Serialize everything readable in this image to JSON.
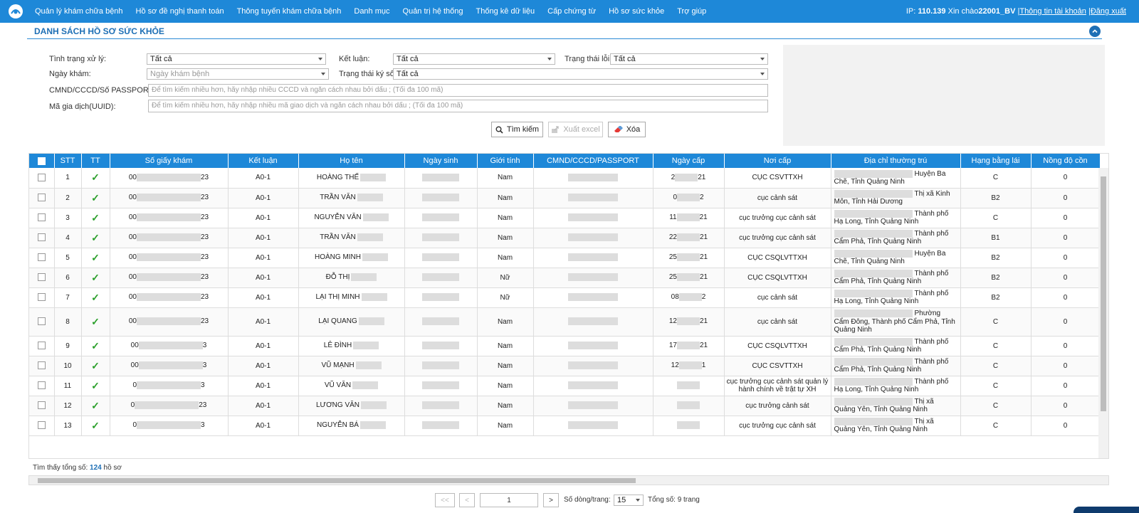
{
  "nav": {
    "items": [
      "Quản lý khám chữa bệnh",
      "Hồ sơ đề nghị thanh toán",
      "Thông tuyến khám chữa bệnh",
      "Danh mục",
      "Quản trị hệ thống",
      "Thống kê dữ liệu",
      "Cấp chứng từ",
      "Hồ sơ sức khỏe",
      "Trợ giúp"
    ],
    "ip_label": "IP:",
    "ip": "110.139",
    "greeting": "Xin chào",
    "user": "22001_BV",
    "sep": "|",
    "account": "Thông tin tài khoản",
    "logout": "Đăng xuất"
  },
  "section": {
    "title": "DANH SÁCH HỒ SƠ SỨC KHỎE"
  },
  "filters": {
    "status_label": "Tình trạng xử lý:",
    "status_value": "Tất cả",
    "conclusion_label": "Kết luận:",
    "conclusion_value": "Tất cả",
    "error_label": "Trạng thái lỗi:",
    "error_value": "Tất cả",
    "date_label": "Ngày khám:",
    "date_placeholder": "Ngày khám bệnh",
    "sign_label": "Trạng thái ký số:",
    "sign_value": "Tất cả",
    "id_label": "CMND/CCCD/Số PASSPORT:",
    "id_placeholder": "Để tìm kiếm nhiều hơn, hãy nhập nhiều CCCD và ngăn cách nhau bởi dấu ; (Tối đa 100 mã)",
    "uuid_label": "Mã gia dịch(UUID):",
    "uuid_placeholder": "Để tìm kiếm nhiều hơn, hãy nhập nhiều mã giao dịch và ngăn cách nhau bởi dấu ; (Tối đa 100 mã)"
  },
  "buttons": {
    "search": "Tìm kiếm",
    "export": "Xuất excel",
    "clear": "Xóa"
  },
  "table": {
    "headers": [
      "STT",
      "TT",
      "Số giấy khám",
      "Kết luận",
      "Họ tên",
      "Ngày sinh",
      "Giới tính",
      "CMND/CCCD/PASSPORT",
      "Ngày cấp",
      "Nơi cấp",
      "Địa chỉ thường trú",
      "Hạng bằng lái",
      "Nồng độ cồn"
    ],
    "rows": [
      {
        "stt": "1",
        "so_a": "00",
        "so_b": "23",
        "kl": "A0-1",
        "name": "HOÀNG THẾ",
        "gender": "Nam",
        "nc_a": "2",
        "nc_b": "21",
        "noi": "CỤC CSVTTXH",
        "addr": "Huyện Ba Chẽ, Tỉnh Quảng Ninh",
        "hang": "C",
        "cn": "0"
      },
      {
        "stt": "2",
        "so_a": "00",
        "so_b": "23",
        "kl": "A0-1",
        "name": "TRẦN VĂN",
        "gender": "Nam",
        "nc_a": "0",
        "nc_b": "2",
        "noi": "cục cảnh sát",
        "addr": "Thị xã Kinh Môn, Tỉnh Hải Dương",
        "hang": "B2",
        "cn": "0"
      },
      {
        "stt": "3",
        "so_a": "00",
        "so_b": "23",
        "kl": "A0-1",
        "name": "NGUYỄN VĂN",
        "gender": "Nam",
        "nc_a": "11",
        "nc_b": "21",
        "noi": "cục trưởng cục cảnh sát",
        "addr": "Thành phố Hạ Long, Tỉnh Quảng Ninh",
        "hang": "C",
        "cn": "0"
      },
      {
        "stt": "4",
        "so_a": "00",
        "so_b": "23",
        "kl": "A0-1",
        "name": "TRẦN VĂN",
        "gender": "Nam",
        "nc_a": "22",
        "nc_b": "21",
        "noi": "cục trưởng cục cảnh sát",
        "addr": "Thành phố Cẩm Phả, Tỉnh Quảng Ninh",
        "hang": "B1",
        "cn": "0"
      },
      {
        "stt": "5",
        "so_a": "00",
        "so_b": "23",
        "kl": "A0-1",
        "name": "HOÀNG MINH",
        "gender": "Nam",
        "nc_a": "25",
        "nc_b": "21",
        "noi": "CỤC CSQLVTTXH",
        "addr": "Huyện Ba Chẽ, Tỉnh Quảng Ninh",
        "hang": "B2",
        "cn": "0"
      },
      {
        "stt": "6",
        "so_a": "00",
        "so_b": "23",
        "kl": "A0-1",
        "name": "ĐỖ THỊ",
        "gender": "Nữ",
        "nc_a": "25",
        "nc_b": "21",
        "noi": "CỤC CSQLVTTXH",
        "addr": "Thành phố Cẩm Phả, Tỉnh Quảng Ninh",
        "hang": "B2",
        "cn": "0"
      },
      {
        "stt": "7",
        "so_a": "00",
        "so_b": "23",
        "kl": "A0-1",
        "name": "LẠI THỊ MINH",
        "gender": "Nữ",
        "nc_a": "08",
        "nc_b": "2",
        "noi": "cục cảnh sát",
        "addr": "Thành phố Hạ Long, Tỉnh Quảng Ninh",
        "hang": "B2",
        "cn": "0"
      },
      {
        "stt": "8",
        "so_a": "00",
        "so_b": "23",
        "kl": "A0-1",
        "name": "LẠI QUANG",
        "gender": "Nam",
        "nc_a": "12",
        "nc_b": "21",
        "noi": "cục cảnh sát",
        "addr": "Phường Cẩm Đông, Thành phố Cẩm Phả, Tỉnh Quảng Ninh",
        "hang": "C",
        "cn": "0"
      },
      {
        "stt": "9",
        "so_a": "00",
        "so_b": "3",
        "kl": "A0-1",
        "name": "LÊ ĐÌNH",
        "gender": "Nam",
        "nc_a": "17",
        "nc_b": "21",
        "noi": "CỤC CSQLVTTXH",
        "addr": "Thành phố Cẩm Phả, Tỉnh Quảng Ninh",
        "hang": "C",
        "cn": "0"
      },
      {
        "stt": "10",
        "so_a": "00",
        "so_b": "3",
        "kl": "A0-1",
        "name": "VŨ MẠNH",
        "gender": "Nam",
        "nc_a": "12",
        "nc_b": "1",
        "noi": "CỤC CSVTTXH",
        "addr": "Thành phố Cẩm Phả, Tỉnh Quảng Ninh",
        "hang": "C",
        "cn": "0"
      },
      {
        "stt": "11",
        "so_a": "0",
        "so_b": "3",
        "kl": "A0-1",
        "name": "VŨ VĂN",
        "gender": "Nam",
        "nc_a": "",
        "nc_b": "",
        "noi": "cục trưởng cục cảnh sát quản lý hành chính về trật tự XH",
        "addr": "Thành phố Hạ Long, Tỉnh Quảng Ninh",
        "hang": "C",
        "cn": "0"
      },
      {
        "stt": "12",
        "so_a": "0",
        "so_b": "23",
        "kl": "A0-1",
        "name": "LƯƠNG VĂN",
        "gender": "Nam",
        "nc_a": "",
        "nc_b": "",
        "noi": "cục trưởng cảnh sát",
        "addr": "Thị xã Quảng Yên, Tỉnh Quảng Ninh",
        "hang": "C",
        "cn": "0"
      },
      {
        "stt": "13",
        "so_a": "0",
        "so_b": "3",
        "kl": "A0-1",
        "name": "NGUYỄN BÁ",
        "gender": "Nam",
        "nc_a": "",
        "nc_b": "",
        "noi": "cục trưởng cục cảnh sát",
        "addr": "Thị xã Quảng Yên, Tỉnh Quảng Ninh",
        "hang": "C",
        "cn": "0"
      }
    ]
  },
  "footer": {
    "total_prefix": "Tìm thấy tổng số:",
    "total": "124",
    "total_suffix": "hồ sơ"
  },
  "pagination": {
    "first": "<<",
    "prev": "<",
    "page": "1",
    "next": ">",
    "rows_label": "Số dòng/trang:",
    "rows_value": "15",
    "total_pages": "Tổng số: 9 trang"
  }
}
